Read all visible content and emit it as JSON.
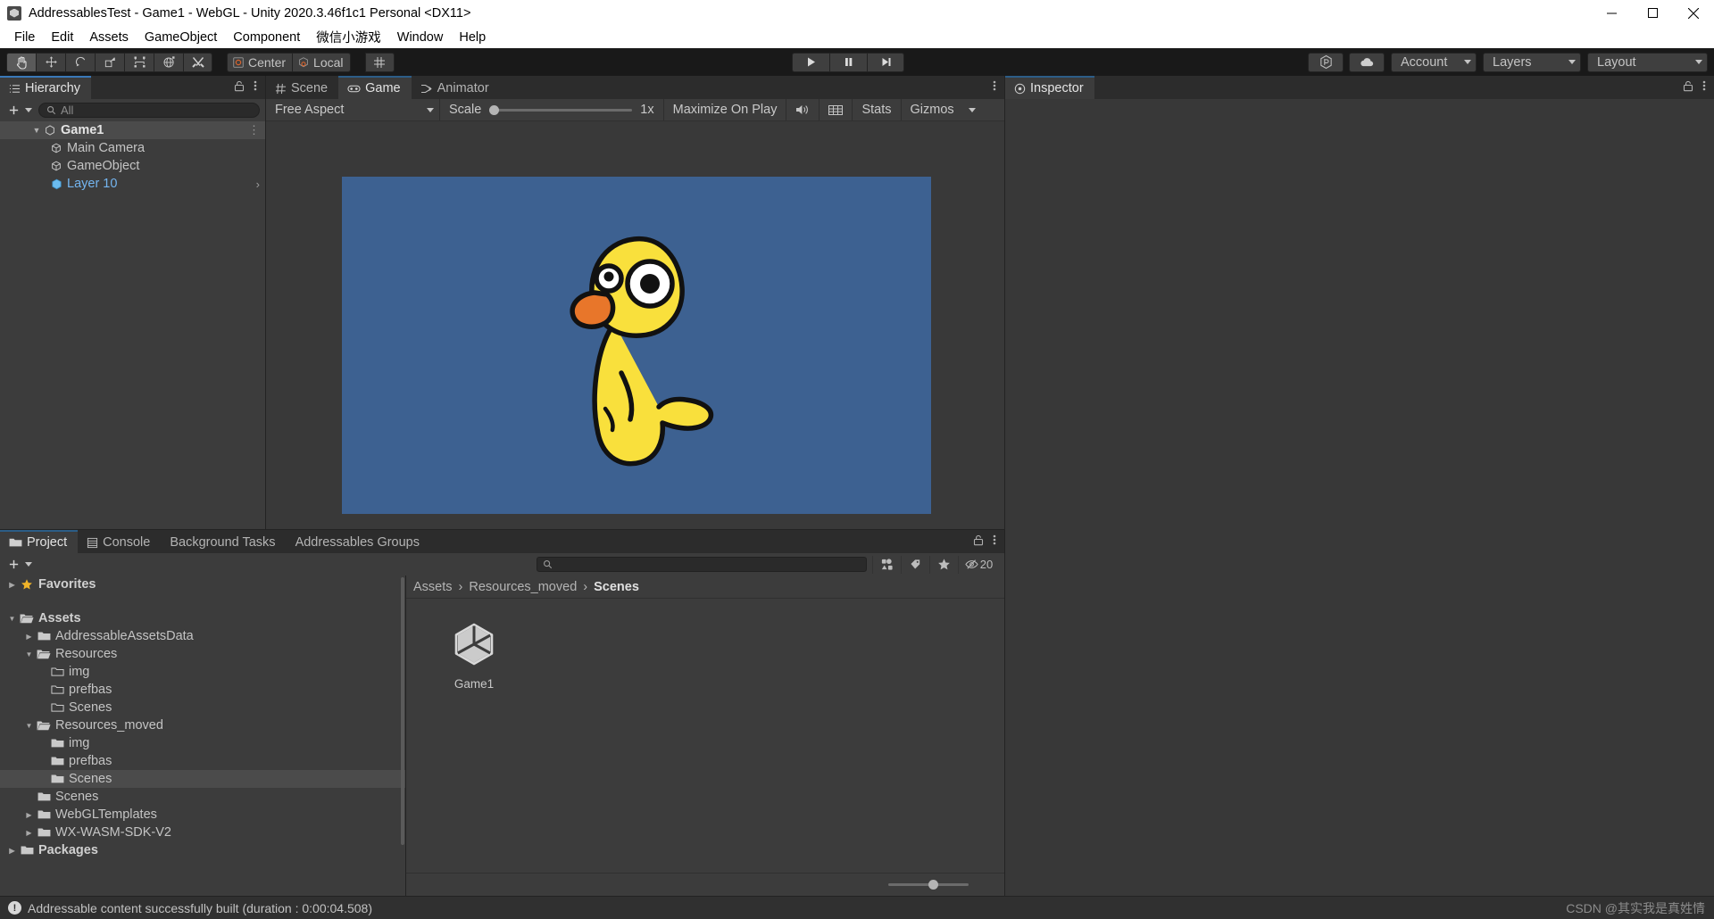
{
  "window": {
    "title": "AddressablesTest - Game1 - WebGL - Unity 2020.3.46f1c1 Personal <DX11>",
    "icon": "unity-icon",
    "minimize": "minimize-button",
    "maximize": "maximize-button",
    "close": "close-button"
  },
  "menubar": {
    "items": [
      {
        "label": "File"
      },
      {
        "label": "Edit"
      },
      {
        "label": "Assets"
      },
      {
        "label": "GameObject"
      },
      {
        "label": "Component"
      },
      {
        "label": "微信小游戏"
      },
      {
        "label": "Window"
      },
      {
        "label": "Help"
      }
    ]
  },
  "toolbar": {
    "tools": [
      {
        "name": "hand-tool",
        "active": true
      },
      {
        "name": "move-tool",
        "active": false
      },
      {
        "name": "rotate-tool",
        "active": false
      },
      {
        "name": "scale-tool",
        "active": false
      },
      {
        "name": "rect-tool",
        "active": false
      },
      {
        "name": "transform-tool",
        "active": false
      },
      {
        "name": "custom-tool",
        "active": false
      }
    ],
    "pivot_label": "Center",
    "rotation_label": "Local",
    "play": "play-button",
    "pause": "pause-button",
    "step": "step-button",
    "collab_label": "",
    "cloud_label": "",
    "account_label": "Account",
    "layers_label": "Layers",
    "layout_label": "Layout"
  },
  "hierarchy": {
    "tab_label": "Hierarchy",
    "search_placeholder": "All",
    "add_label": "+",
    "rows": [
      {
        "label": "Game1",
        "depth": 0,
        "icon": "scene-icon",
        "expanded": true,
        "selected": true,
        "bold": true,
        "chevron": false,
        "blue": false
      },
      {
        "label": "Main Camera",
        "depth": 1,
        "icon": "gameobject-icon",
        "expanded": null,
        "selected": false,
        "bold": false,
        "chevron": false,
        "blue": false
      },
      {
        "label": "GameObject",
        "depth": 1,
        "icon": "gameobject-icon",
        "expanded": null,
        "selected": false,
        "bold": false,
        "chevron": false,
        "blue": false
      },
      {
        "label": "Layer 10",
        "depth": 1,
        "icon": "prefab-icon",
        "expanded": null,
        "selected": false,
        "bold": false,
        "chevron": true,
        "blue": true
      }
    ]
  },
  "gameview": {
    "tabs": [
      {
        "label": "Scene",
        "icon": "scene-grid-icon",
        "active": false
      },
      {
        "label": "Game",
        "icon": "gamepad-icon",
        "active": true
      },
      {
        "label": "Animator",
        "icon": "animator-icon",
        "active": false
      }
    ],
    "aspect_label": "Free Aspect",
    "scale_label": "Scale",
    "scale_value": "1x",
    "maximize_label": "Maximize On Play",
    "mute_label": "mute-audio-icon",
    "stats_label": "Stats",
    "gizmos_label": "Gizmos",
    "background_color": "#3d6191"
  },
  "project": {
    "tabs": [
      {
        "label": "Project",
        "icon": "folder-icon",
        "active": true
      },
      {
        "label": "Console",
        "icon": "console-icon",
        "active": false
      },
      {
        "label": "Background Tasks",
        "icon": "",
        "active": false
      },
      {
        "label": "Addressables Groups",
        "icon": "",
        "active": false
      }
    ],
    "add_label": "+",
    "search_placeholder": "",
    "hidden_count": "20",
    "tree": [
      {
        "label": "Favorites",
        "depth": 0,
        "icon": "star-icon",
        "arrow": "collapsed",
        "bold": true,
        "selected": false
      },
      {
        "label": "",
        "depth": 0,
        "icon": "",
        "arrow": "none",
        "bold": false,
        "selected": false,
        "spacer": true
      },
      {
        "label": "Assets",
        "depth": 0,
        "icon": "folder-open-icon",
        "arrow": "expanded",
        "bold": true,
        "selected": false
      },
      {
        "label": "AddressableAssetsData",
        "depth": 1,
        "icon": "folder-icon",
        "arrow": "collapsed",
        "bold": false,
        "selected": false
      },
      {
        "label": "Resources",
        "depth": 1,
        "icon": "folder-open-icon",
        "arrow": "expanded",
        "bold": false,
        "selected": false
      },
      {
        "label": "img",
        "depth": 2,
        "icon": "folder-empty-icon",
        "arrow": "none",
        "bold": false,
        "selected": false
      },
      {
        "label": "prefbas",
        "depth": 2,
        "icon": "folder-empty-icon",
        "arrow": "none",
        "bold": false,
        "selected": false
      },
      {
        "label": "Scenes",
        "depth": 2,
        "icon": "folder-empty-icon",
        "arrow": "none",
        "bold": false,
        "selected": false
      },
      {
        "label": "Resources_moved",
        "depth": 1,
        "icon": "folder-open-icon",
        "arrow": "expanded",
        "bold": false,
        "selected": false
      },
      {
        "label": "img",
        "depth": 2,
        "icon": "folder-icon",
        "arrow": "none",
        "bold": false,
        "selected": false
      },
      {
        "label": "prefbas",
        "depth": 2,
        "icon": "folder-icon",
        "arrow": "none",
        "bold": false,
        "selected": false
      },
      {
        "label": "Scenes",
        "depth": 2,
        "icon": "folder-icon",
        "arrow": "none",
        "bold": false,
        "selected": true
      },
      {
        "label": "Scenes",
        "depth": 1,
        "icon": "folder-icon",
        "arrow": "none",
        "bold": false,
        "selected": false
      },
      {
        "label": "WebGLTemplates",
        "depth": 1,
        "icon": "folder-icon",
        "arrow": "collapsed",
        "bold": false,
        "selected": false
      },
      {
        "label": "WX-WASM-SDK-V2",
        "depth": 1,
        "icon": "folder-icon",
        "arrow": "collapsed",
        "bold": false,
        "selected": false
      },
      {
        "label": "Packages",
        "depth": 0,
        "icon": "folder-icon",
        "arrow": "collapsed",
        "bold": true,
        "selected": false
      }
    ],
    "breadcrumb": [
      {
        "label": "Assets",
        "current": false
      },
      {
        "label": "Resources_moved",
        "current": false
      },
      {
        "label": "Scenes",
        "current": true
      }
    ],
    "assets": [
      {
        "name": "Game1",
        "icon": "unity-scene-icon"
      }
    ]
  },
  "inspector": {
    "tab_label": "Inspector",
    "icon": "inspector-icon"
  },
  "statusbar": {
    "message": "Addressable content successfully built (duration : 0:00:04.508)",
    "icon": "info-icon",
    "watermark": "CSDN @其实我是真姓情"
  }
}
